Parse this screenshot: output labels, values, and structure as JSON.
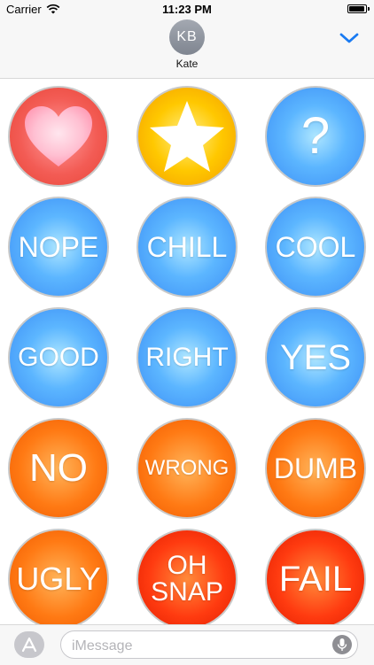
{
  "status_bar": {
    "carrier": "Carrier",
    "time": "11:23 PM",
    "wifi_icon": "wifi-icon",
    "battery_icon": "battery-icon"
  },
  "header": {
    "avatar_initials": "KB",
    "contact_name": "Kate",
    "collapse_icon": "chevron-down-icon",
    "accent_color": "#1a7bf2"
  },
  "stickers": [
    {
      "label": "",
      "icon": "heart-icon",
      "color": "red"
    },
    {
      "label": "",
      "icon": "star-icon",
      "color": "gold"
    },
    {
      "label": "?",
      "color": "blue"
    },
    {
      "label": "NOPE",
      "color": "blue"
    },
    {
      "label": "CHILL",
      "color": "blue"
    },
    {
      "label": "COOL",
      "color": "blue"
    },
    {
      "label": "GOOD",
      "color": "blue"
    },
    {
      "label": "RIGHT",
      "color": "blue"
    },
    {
      "label": "YES",
      "color": "blue"
    },
    {
      "label": "NO",
      "color": "orange"
    },
    {
      "label": "WRONG",
      "color": "orange"
    },
    {
      "label": "DUMB",
      "color": "orange"
    },
    {
      "label": "UGLY",
      "color": "orange"
    },
    {
      "label": "OH SNAP",
      "color": "red"
    },
    {
      "label": "FAIL",
      "color": "red"
    }
  ],
  "input_bar": {
    "appstore_icon": "app-store-icon",
    "placeholder": "iMessage",
    "mic_icon": "microphone-icon"
  }
}
